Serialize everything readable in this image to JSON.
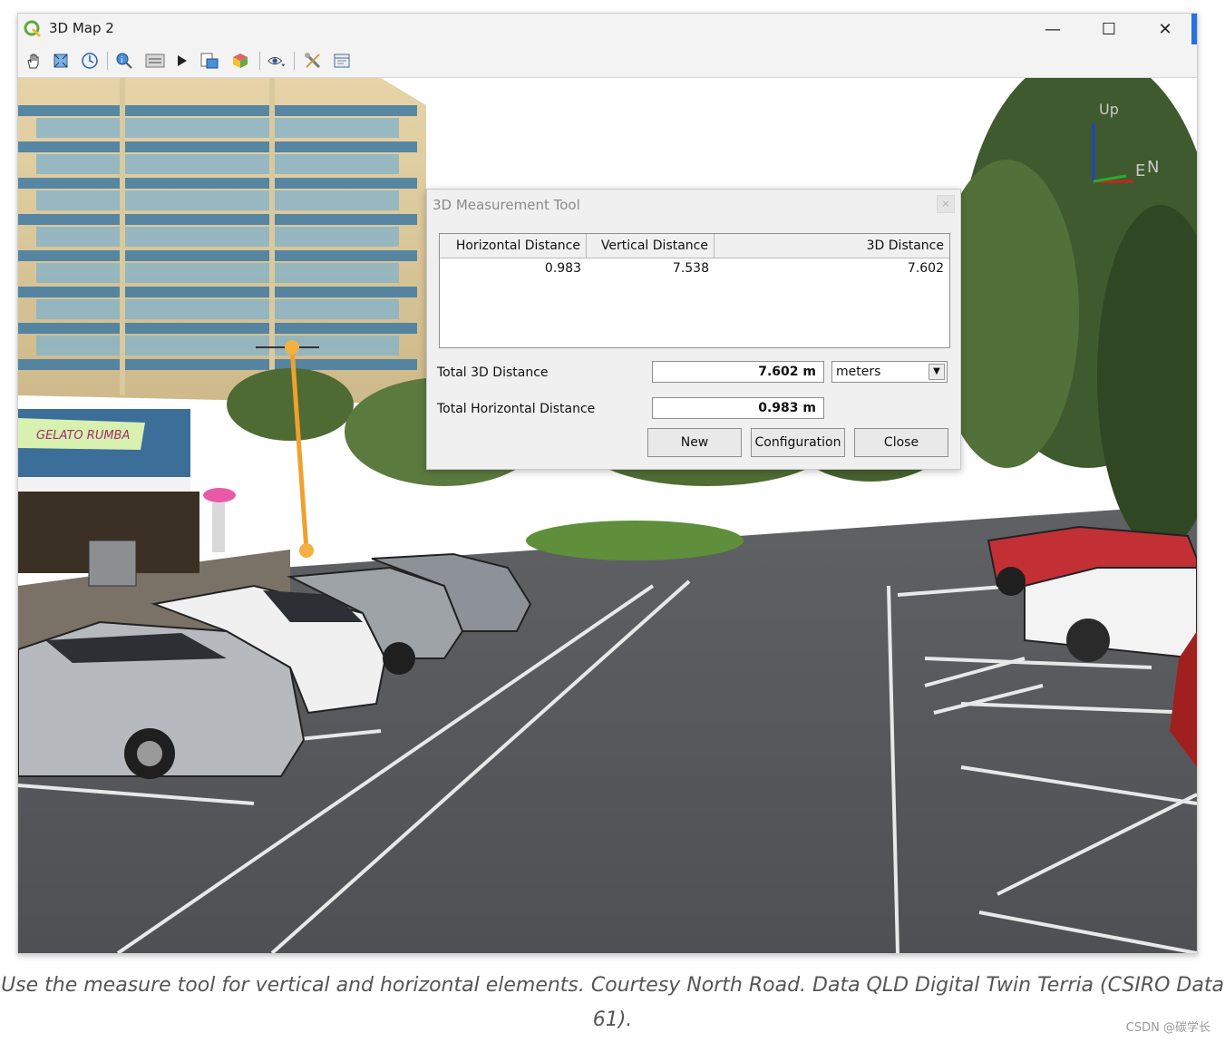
{
  "window": {
    "title": "3D Map 2",
    "minimize": "—",
    "maximize": "☐",
    "close": "✕"
  },
  "toolbar": {
    "icons": [
      "pan-icon",
      "zoom-full-icon",
      "camera-reset-icon",
      "identify-icon",
      "measure-line-icon",
      "play-animation-icon",
      "export-scene-icon",
      "3d-layer-icon",
      "view-options-icon",
      "settings-tools-icon",
      "map-theme-icon"
    ]
  },
  "viewport": {
    "storefront_sign": "GELATO RUMBA",
    "axes": {
      "up": "Up",
      "east": "E",
      "north": "N"
    }
  },
  "dialog": {
    "title": "3D Measurement Tool",
    "columns": [
      "Horizontal Distance",
      "Vertical Distance",
      "3D Distance"
    ],
    "rows": [
      {
        "horizontal": "0.983",
        "vertical": "7.538",
        "distance_3d": "7.602"
      }
    ],
    "total_3d_label": "Total 3D Distance",
    "total_3d_value": "7.602 m",
    "units": "meters",
    "total_horizontal_label": "Total Horizontal Distance",
    "total_horizontal_value": "0.983 m",
    "buttons": {
      "new": "New",
      "configuration": "Configuration",
      "close": "Close"
    }
  },
  "caption": "Use the measure tool for vertical and horizontal elements. Courtesy North Road. Data QLD Digital Twin Terria (CSIRO Data 61).",
  "watermark": "CSDN @碳学长",
  "colors": {
    "measure_line": "#f0a030",
    "qgis_green": "#5fa83a",
    "accent": "#2a6fe0"
  }
}
